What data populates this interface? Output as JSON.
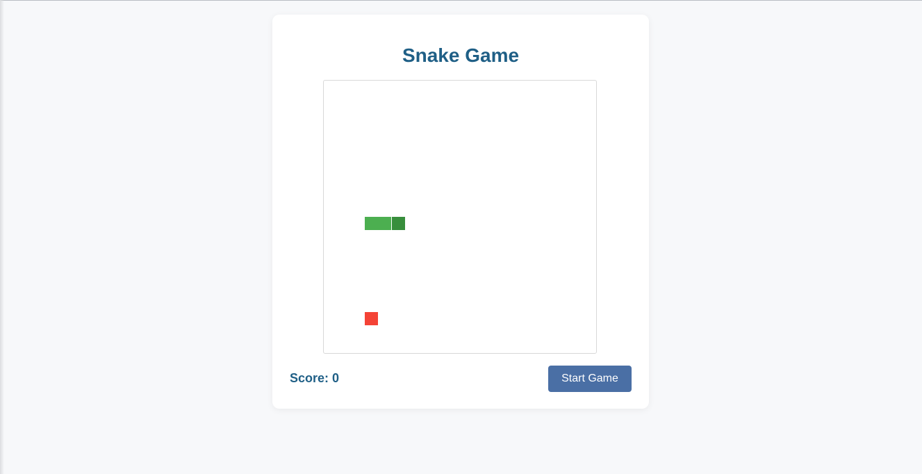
{
  "game": {
    "title": "Snake Game",
    "score_label": "Score: 0",
    "score": 0,
    "start_label": "Start Game"
  },
  "board": {
    "grid_size": 20,
    "snake": [
      {
        "col": 3,
        "row": 10,
        "part": "body"
      },
      {
        "col": 4,
        "row": 10,
        "part": "body"
      },
      {
        "col": 5,
        "row": 10,
        "part": "head"
      }
    ],
    "food": {
      "col": 3,
      "row": 17
    },
    "colors": {
      "snake_body": "#4caf50",
      "snake_head": "#388e3c",
      "food": "#f44336"
    }
  }
}
